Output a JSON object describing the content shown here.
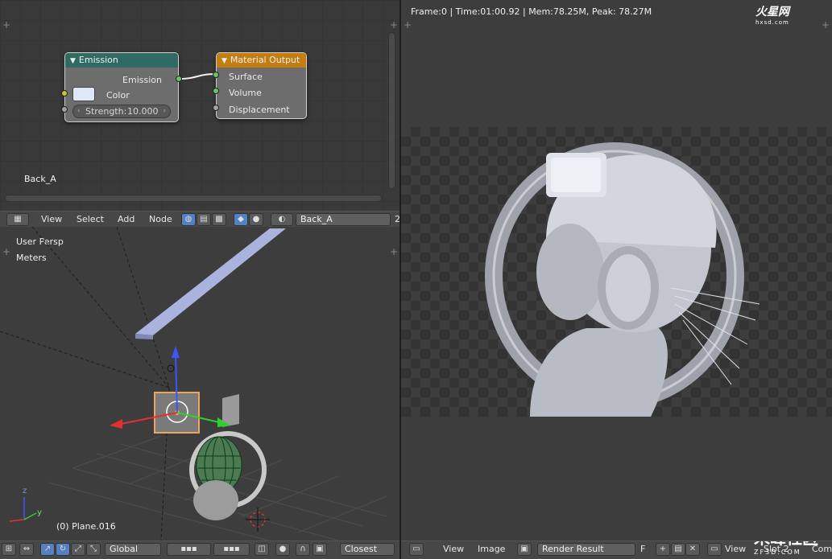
{
  "node_editor": {
    "material_label": "Back_A",
    "emission_node": {
      "title": "Emission",
      "output_label": "Emission",
      "color_label": "Color",
      "strength_label": "Strength:",
      "strength_value": "10.000"
    },
    "output_node": {
      "title": "Material Output",
      "inputs": [
        "Surface",
        "Volume",
        "Displacement"
      ]
    },
    "header": {
      "menus": [
        "View",
        "Select",
        "Add",
        "Node"
      ],
      "material_field": "Back_A",
      "field_suffix": "2"
    }
  },
  "viewport": {
    "view_name": "User Persp",
    "units": "Meters",
    "object_label": "(0) Plane.016",
    "axis_z": "z",
    "axis_y": "y",
    "header": {
      "orientation": "Global",
      "snap": "Closest"
    }
  },
  "image_editor": {
    "stats": "Frame:0 | Time:01:00.92 | Mem:78.25M, Peak: 78.27M",
    "logo_top": "火星网",
    "logo_top_sub": "hxsd.com",
    "header": {
      "menus": [
        "View",
        "Image"
      ],
      "image_field": "Render Result",
      "f_label": "F",
      "view_label": "View",
      "slot_label": "Slot 2",
      "comp_label": "Com"
    },
    "watermark": {
      "main": "朱峰社区",
      "sub": "ZF3D.COM"
    }
  },
  "colors": {
    "emission_header": "#2f6a63",
    "output_header": "#c37d10",
    "socket_green": "#63c763",
    "socket_yellow": "#c7c729",
    "selected_orange": "#f0a55c"
  }
}
